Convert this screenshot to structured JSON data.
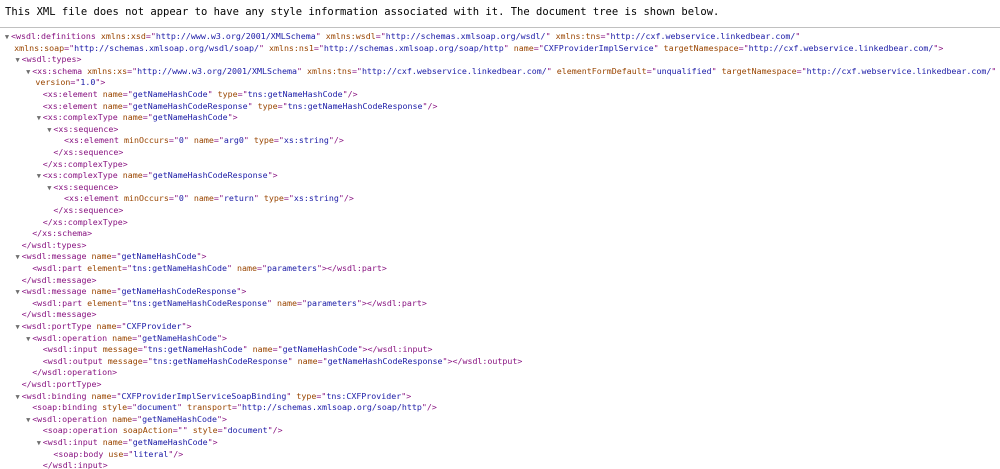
{
  "banner": {
    "message": "This XML file does not appear to have any style information associated with it. The document tree is shown below."
  },
  "colors": {
    "tag": "#881280",
    "attr_name": "#994500",
    "attr_value": "#1a1aa6",
    "text": "#000000",
    "toggle": "#6e6e6e"
  },
  "lines": [
    {
      "indent": 0,
      "toggle": true,
      "parts": [
        [
          "t",
          "<wsdl:definitions"
        ],
        [
          "s",
          " "
        ],
        [
          "a",
          "xmlns:xsd"
        ],
        [
          "t",
          "=\""
        ],
        [
          "v",
          "http://www.w3.org/2001/XMLSchema"
        ],
        [
          "t",
          "\""
        ],
        [
          "s",
          " "
        ],
        [
          "a",
          "xmlns:wsdl"
        ],
        [
          "t",
          "=\""
        ],
        [
          "v",
          "http://schemas.xmlsoap.org/wsdl/"
        ],
        [
          "t",
          "\""
        ],
        [
          "s",
          " "
        ],
        [
          "a",
          "xmlns:tns"
        ],
        [
          "t",
          "=\""
        ],
        [
          "v",
          "http://cxf.webservice.linkedbear.com/"
        ],
        [
          "t",
          "\""
        ]
      ]
    },
    {
      "indent": 0.3,
      "toggle": false,
      "parts": [
        [
          "a",
          "xmlns:soap"
        ],
        [
          "t",
          "=\""
        ],
        [
          "v",
          "http://schemas.xmlsoap.org/wsdl/soap/"
        ],
        [
          "t",
          "\""
        ],
        [
          "s",
          " "
        ],
        [
          "a",
          "xmlns:ns1"
        ],
        [
          "t",
          "=\""
        ],
        [
          "v",
          "http://schemas.xmlsoap.org/soap/http"
        ],
        [
          "t",
          "\""
        ],
        [
          "s",
          " "
        ],
        [
          "a",
          "name"
        ],
        [
          "t",
          "=\""
        ],
        [
          "v",
          "CXFProviderImplService"
        ],
        [
          "t",
          "\""
        ],
        [
          "s",
          " "
        ],
        [
          "a",
          "targetNamespace"
        ],
        [
          "t",
          "=\""
        ],
        [
          "v",
          "http://cxf.webservice.linkedbear.com/"
        ],
        [
          "t",
          "\">"
        ]
      ]
    },
    {
      "indent": 1,
      "toggle": true,
      "parts": [
        [
          "t",
          "<wsdl:types>"
        ]
      ]
    },
    {
      "indent": 2,
      "toggle": true,
      "parts": [
        [
          "t",
          "<xs:schema"
        ],
        [
          "s",
          " "
        ],
        [
          "a",
          "xmlns:xs"
        ],
        [
          "t",
          "=\""
        ],
        [
          "v",
          "http://www.w3.org/2001/XMLSchema"
        ],
        [
          "t",
          "\""
        ],
        [
          "s",
          " "
        ],
        [
          "a",
          "xmlns:tns"
        ],
        [
          "t",
          "=\""
        ],
        [
          "v",
          "http://cxf.webservice.linkedbear.com/"
        ],
        [
          "t",
          "\""
        ],
        [
          "s",
          " "
        ],
        [
          "a",
          "elementFormDefault"
        ],
        [
          "t",
          "=\""
        ],
        [
          "v",
          "unqualified"
        ],
        [
          "t",
          "\""
        ],
        [
          "s",
          " "
        ],
        [
          "a",
          "targetNamespace"
        ],
        [
          "t",
          "=\""
        ],
        [
          "v",
          "http://cxf.webservice.linkedbear.com/"
        ],
        [
          "t",
          "\""
        ]
      ]
    },
    {
      "indent": 2.3,
      "toggle": false,
      "parts": [
        [
          "a",
          "version"
        ],
        [
          "t",
          "=\""
        ],
        [
          "v",
          "1.0"
        ],
        [
          "t",
          "\">"
        ]
      ]
    },
    {
      "indent": 3,
      "toggle": false,
      "parts": [
        [
          "t",
          "<xs:element"
        ],
        [
          "s",
          " "
        ],
        [
          "a",
          "name"
        ],
        [
          "t",
          "=\""
        ],
        [
          "v",
          "getNameHashCode"
        ],
        [
          "t",
          "\""
        ],
        [
          "s",
          " "
        ],
        [
          "a",
          "type"
        ],
        [
          "t",
          "=\""
        ],
        [
          "v",
          "tns:getNameHashCode"
        ],
        [
          "t",
          "\"/>"
        ]
      ]
    },
    {
      "indent": 3,
      "toggle": false,
      "parts": [
        [
          "t",
          "<xs:element"
        ],
        [
          "s",
          " "
        ],
        [
          "a",
          "name"
        ],
        [
          "t",
          "=\""
        ],
        [
          "v",
          "getNameHashCodeResponse"
        ],
        [
          "t",
          "\""
        ],
        [
          "s",
          " "
        ],
        [
          "a",
          "type"
        ],
        [
          "t",
          "=\""
        ],
        [
          "v",
          "tns:getNameHashCodeResponse"
        ],
        [
          "t",
          "\"/>"
        ]
      ]
    },
    {
      "indent": 3,
      "toggle": true,
      "parts": [
        [
          "t",
          "<xs:complexType"
        ],
        [
          "s",
          " "
        ],
        [
          "a",
          "name"
        ],
        [
          "t",
          "=\""
        ],
        [
          "v",
          "getNameHashCode"
        ],
        [
          "t",
          "\">"
        ]
      ]
    },
    {
      "indent": 4,
      "toggle": true,
      "parts": [
        [
          "t",
          "<xs:sequence>"
        ]
      ]
    },
    {
      "indent": 5,
      "toggle": false,
      "parts": [
        [
          "t",
          "<xs:element"
        ],
        [
          "s",
          " "
        ],
        [
          "a",
          "minOccurs"
        ],
        [
          "t",
          "=\""
        ],
        [
          "v",
          "0"
        ],
        [
          "t",
          "\""
        ],
        [
          "s",
          " "
        ],
        [
          "a",
          "name"
        ],
        [
          "t",
          "=\""
        ],
        [
          "v",
          "arg0"
        ],
        [
          "t",
          "\""
        ],
        [
          "s",
          " "
        ],
        [
          "a",
          "type"
        ],
        [
          "t",
          "=\""
        ],
        [
          "v",
          "xs:string"
        ],
        [
          "t",
          "\"/>"
        ]
      ]
    },
    {
      "indent": 4,
      "toggle": false,
      "parts": [
        [
          "t",
          "</xs:sequence>"
        ]
      ]
    },
    {
      "indent": 3,
      "toggle": false,
      "parts": [
        [
          "t",
          "</xs:complexType>"
        ]
      ]
    },
    {
      "indent": 3,
      "toggle": true,
      "parts": [
        [
          "t",
          "<xs:complexType"
        ],
        [
          "s",
          " "
        ],
        [
          "a",
          "name"
        ],
        [
          "t",
          "=\""
        ],
        [
          "v",
          "getNameHashCodeResponse"
        ],
        [
          "t",
          "\">"
        ]
      ]
    },
    {
      "indent": 4,
      "toggle": true,
      "parts": [
        [
          "t",
          "<xs:sequence>"
        ]
      ]
    },
    {
      "indent": 5,
      "toggle": false,
      "parts": [
        [
          "t",
          "<xs:element"
        ],
        [
          "s",
          " "
        ],
        [
          "a",
          "minOccurs"
        ],
        [
          "t",
          "=\""
        ],
        [
          "v",
          "0"
        ],
        [
          "t",
          "\""
        ],
        [
          "s",
          " "
        ],
        [
          "a",
          "name"
        ],
        [
          "t",
          "=\""
        ],
        [
          "v",
          "return"
        ],
        [
          "t",
          "\""
        ],
        [
          "s",
          " "
        ],
        [
          "a",
          "type"
        ],
        [
          "t",
          "=\""
        ],
        [
          "v",
          "xs:string"
        ],
        [
          "t",
          "\"/>"
        ]
      ]
    },
    {
      "indent": 4,
      "toggle": false,
      "parts": [
        [
          "t",
          "</xs:sequence>"
        ]
      ]
    },
    {
      "indent": 3,
      "toggle": false,
      "parts": [
        [
          "t",
          "</xs:complexType>"
        ]
      ]
    },
    {
      "indent": 2,
      "toggle": false,
      "parts": [
        [
          "t",
          "</xs:schema>"
        ]
      ]
    },
    {
      "indent": 1,
      "toggle": false,
      "parts": [
        [
          "t",
          "</wsdl:types>"
        ]
      ]
    },
    {
      "indent": 1,
      "toggle": true,
      "parts": [
        [
          "t",
          "<wsdl:message"
        ],
        [
          "s",
          " "
        ],
        [
          "a",
          "name"
        ],
        [
          "t",
          "=\""
        ],
        [
          "v",
          "getNameHashCode"
        ],
        [
          "t",
          "\">"
        ]
      ]
    },
    {
      "indent": 2,
      "toggle": false,
      "parts": [
        [
          "t",
          "<wsdl:part"
        ],
        [
          "s",
          " "
        ],
        [
          "a",
          "element"
        ],
        [
          "t",
          "=\""
        ],
        [
          "v",
          "tns:getNameHashCode"
        ],
        [
          "t",
          "\""
        ],
        [
          "s",
          " "
        ],
        [
          "a",
          "name"
        ],
        [
          "t",
          "=\""
        ],
        [
          "v",
          "parameters"
        ],
        [
          "t",
          "\"></wsdl:part>"
        ]
      ]
    },
    {
      "indent": 1,
      "toggle": false,
      "parts": [
        [
          "t",
          "</wsdl:message>"
        ]
      ]
    },
    {
      "indent": 1,
      "toggle": true,
      "parts": [
        [
          "t",
          "<wsdl:message"
        ],
        [
          "s",
          " "
        ],
        [
          "a",
          "name"
        ],
        [
          "t",
          "=\""
        ],
        [
          "v",
          "getNameHashCodeResponse"
        ],
        [
          "t",
          "\">"
        ]
      ]
    },
    {
      "indent": 2,
      "toggle": false,
      "parts": [
        [
          "t",
          "<wsdl:part"
        ],
        [
          "s",
          " "
        ],
        [
          "a",
          "element"
        ],
        [
          "t",
          "=\""
        ],
        [
          "v",
          "tns:getNameHashCodeResponse"
        ],
        [
          "t",
          "\""
        ],
        [
          "s",
          " "
        ],
        [
          "a",
          "name"
        ],
        [
          "t",
          "=\""
        ],
        [
          "v",
          "parameters"
        ],
        [
          "t",
          "\"></wsdl:part>"
        ]
      ]
    },
    {
      "indent": 1,
      "toggle": false,
      "parts": [
        [
          "t",
          "</wsdl:message>"
        ]
      ]
    },
    {
      "indent": 1,
      "toggle": true,
      "parts": [
        [
          "t",
          "<wsdl:portType"
        ],
        [
          "s",
          " "
        ],
        [
          "a",
          "name"
        ],
        [
          "t",
          "=\""
        ],
        [
          "v",
          "CXFProvider"
        ],
        [
          "t",
          "\">"
        ]
      ]
    },
    {
      "indent": 2,
      "toggle": true,
      "parts": [
        [
          "t",
          "<wsdl:operation"
        ],
        [
          "s",
          " "
        ],
        [
          "a",
          "name"
        ],
        [
          "t",
          "=\""
        ],
        [
          "v",
          "getNameHashCode"
        ],
        [
          "t",
          "\">"
        ]
      ]
    },
    {
      "indent": 3,
      "toggle": false,
      "parts": [
        [
          "t",
          "<wsdl:input"
        ],
        [
          "s",
          " "
        ],
        [
          "a",
          "message"
        ],
        [
          "t",
          "=\""
        ],
        [
          "v",
          "tns:getNameHashCode"
        ],
        [
          "t",
          "\""
        ],
        [
          "s",
          " "
        ],
        [
          "a",
          "name"
        ],
        [
          "t",
          "=\""
        ],
        [
          "v",
          "getNameHashCode"
        ],
        [
          "t",
          "\"></wsdl:input>"
        ]
      ]
    },
    {
      "indent": 3,
      "toggle": false,
      "parts": [
        [
          "t",
          "<wsdl:output"
        ],
        [
          "s",
          " "
        ],
        [
          "a",
          "message"
        ],
        [
          "t",
          "=\""
        ],
        [
          "v",
          "tns:getNameHashCodeResponse"
        ],
        [
          "t",
          "\""
        ],
        [
          "s",
          " "
        ],
        [
          "a",
          "name"
        ],
        [
          "t",
          "=\""
        ],
        [
          "v",
          "getNameHashCodeResponse"
        ],
        [
          "t",
          "\"></wsdl:output>"
        ]
      ]
    },
    {
      "indent": 2,
      "toggle": false,
      "parts": [
        [
          "t",
          "</wsdl:operation>"
        ]
      ]
    },
    {
      "indent": 1,
      "toggle": false,
      "parts": [
        [
          "t",
          "</wsdl:portType>"
        ]
      ]
    },
    {
      "indent": 1,
      "toggle": true,
      "parts": [
        [
          "t",
          "<wsdl:binding"
        ],
        [
          "s",
          " "
        ],
        [
          "a",
          "name"
        ],
        [
          "t",
          "=\""
        ],
        [
          "v",
          "CXFProviderImplServiceSoapBinding"
        ],
        [
          "t",
          "\""
        ],
        [
          "s",
          " "
        ],
        [
          "a",
          "type"
        ],
        [
          "t",
          "=\""
        ],
        [
          "v",
          "tns:CXFProvider"
        ],
        [
          "t",
          "\">"
        ]
      ]
    },
    {
      "indent": 2,
      "toggle": false,
      "parts": [
        [
          "t",
          "<soap:binding"
        ],
        [
          "s",
          " "
        ],
        [
          "a",
          "style"
        ],
        [
          "t",
          "=\""
        ],
        [
          "v",
          "document"
        ],
        [
          "t",
          "\""
        ],
        [
          "s",
          " "
        ],
        [
          "a",
          "transport"
        ],
        [
          "t",
          "=\""
        ],
        [
          "v",
          "http://schemas.xmlsoap.org/soap/http"
        ],
        [
          "t",
          "\"/>"
        ]
      ]
    },
    {
      "indent": 2,
      "toggle": true,
      "parts": [
        [
          "t",
          "<wsdl:operation"
        ],
        [
          "s",
          " "
        ],
        [
          "a",
          "name"
        ],
        [
          "t",
          "=\""
        ],
        [
          "v",
          "getNameHashCode"
        ],
        [
          "t",
          "\">"
        ]
      ]
    },
    {
      "indent": 3,
      "toggle": false,
      "parts": [
        [
          "t",
          "<soap:operation"
        ],
        [
          "s",
          " "
        ],
        [
          "a",
          "soapAction"
        ],
        [
          "t",
          "=\""
        ],
        [
          "v",
          ""
        ],
        [
          "t",
          "\""
        ],
        [
          "s",
          " "
        ],
        [
          "a",
          "style"
        ],
        [
          "t",
          "=\""
        ],
        [
          "v",
          "document"
        ],
        [
          "t",
          "\"/>"
        ]
      ]
    },
    {
      "indent": 3,
      "toggle": true,
      "parts": [
        [
          "t",
          "<wsdl:input"
        ],
        [
          "s",
          " "
        ],
        [
          "a",
          "name"
        ],
        [
          "t",
          "=\""
        ],
        [
          "v",
          "getNameHashCode"
        ],
        [
          "t",
          "\">"
        ]
      ]
    },
    {
      "indent": 4,
      "toggle": false,
      "parts": [
        [
          "t",
          "<soap:body"
        ],
        [
          "s",
          " "
        ],
        [
          "a",
          "use"
        ],
        [
          "t",
          "=\""
        ],
        [
          "v",
          "literal"
        ],
        [
          "t",
          "\"/>"
        ]
      ]
    },
    {
      "indent": 3,
      "toggle": false,
      "parts": [
        [
          "t",
          "</wsdl:input>"
        ]
      ]
    }
  ]
}
